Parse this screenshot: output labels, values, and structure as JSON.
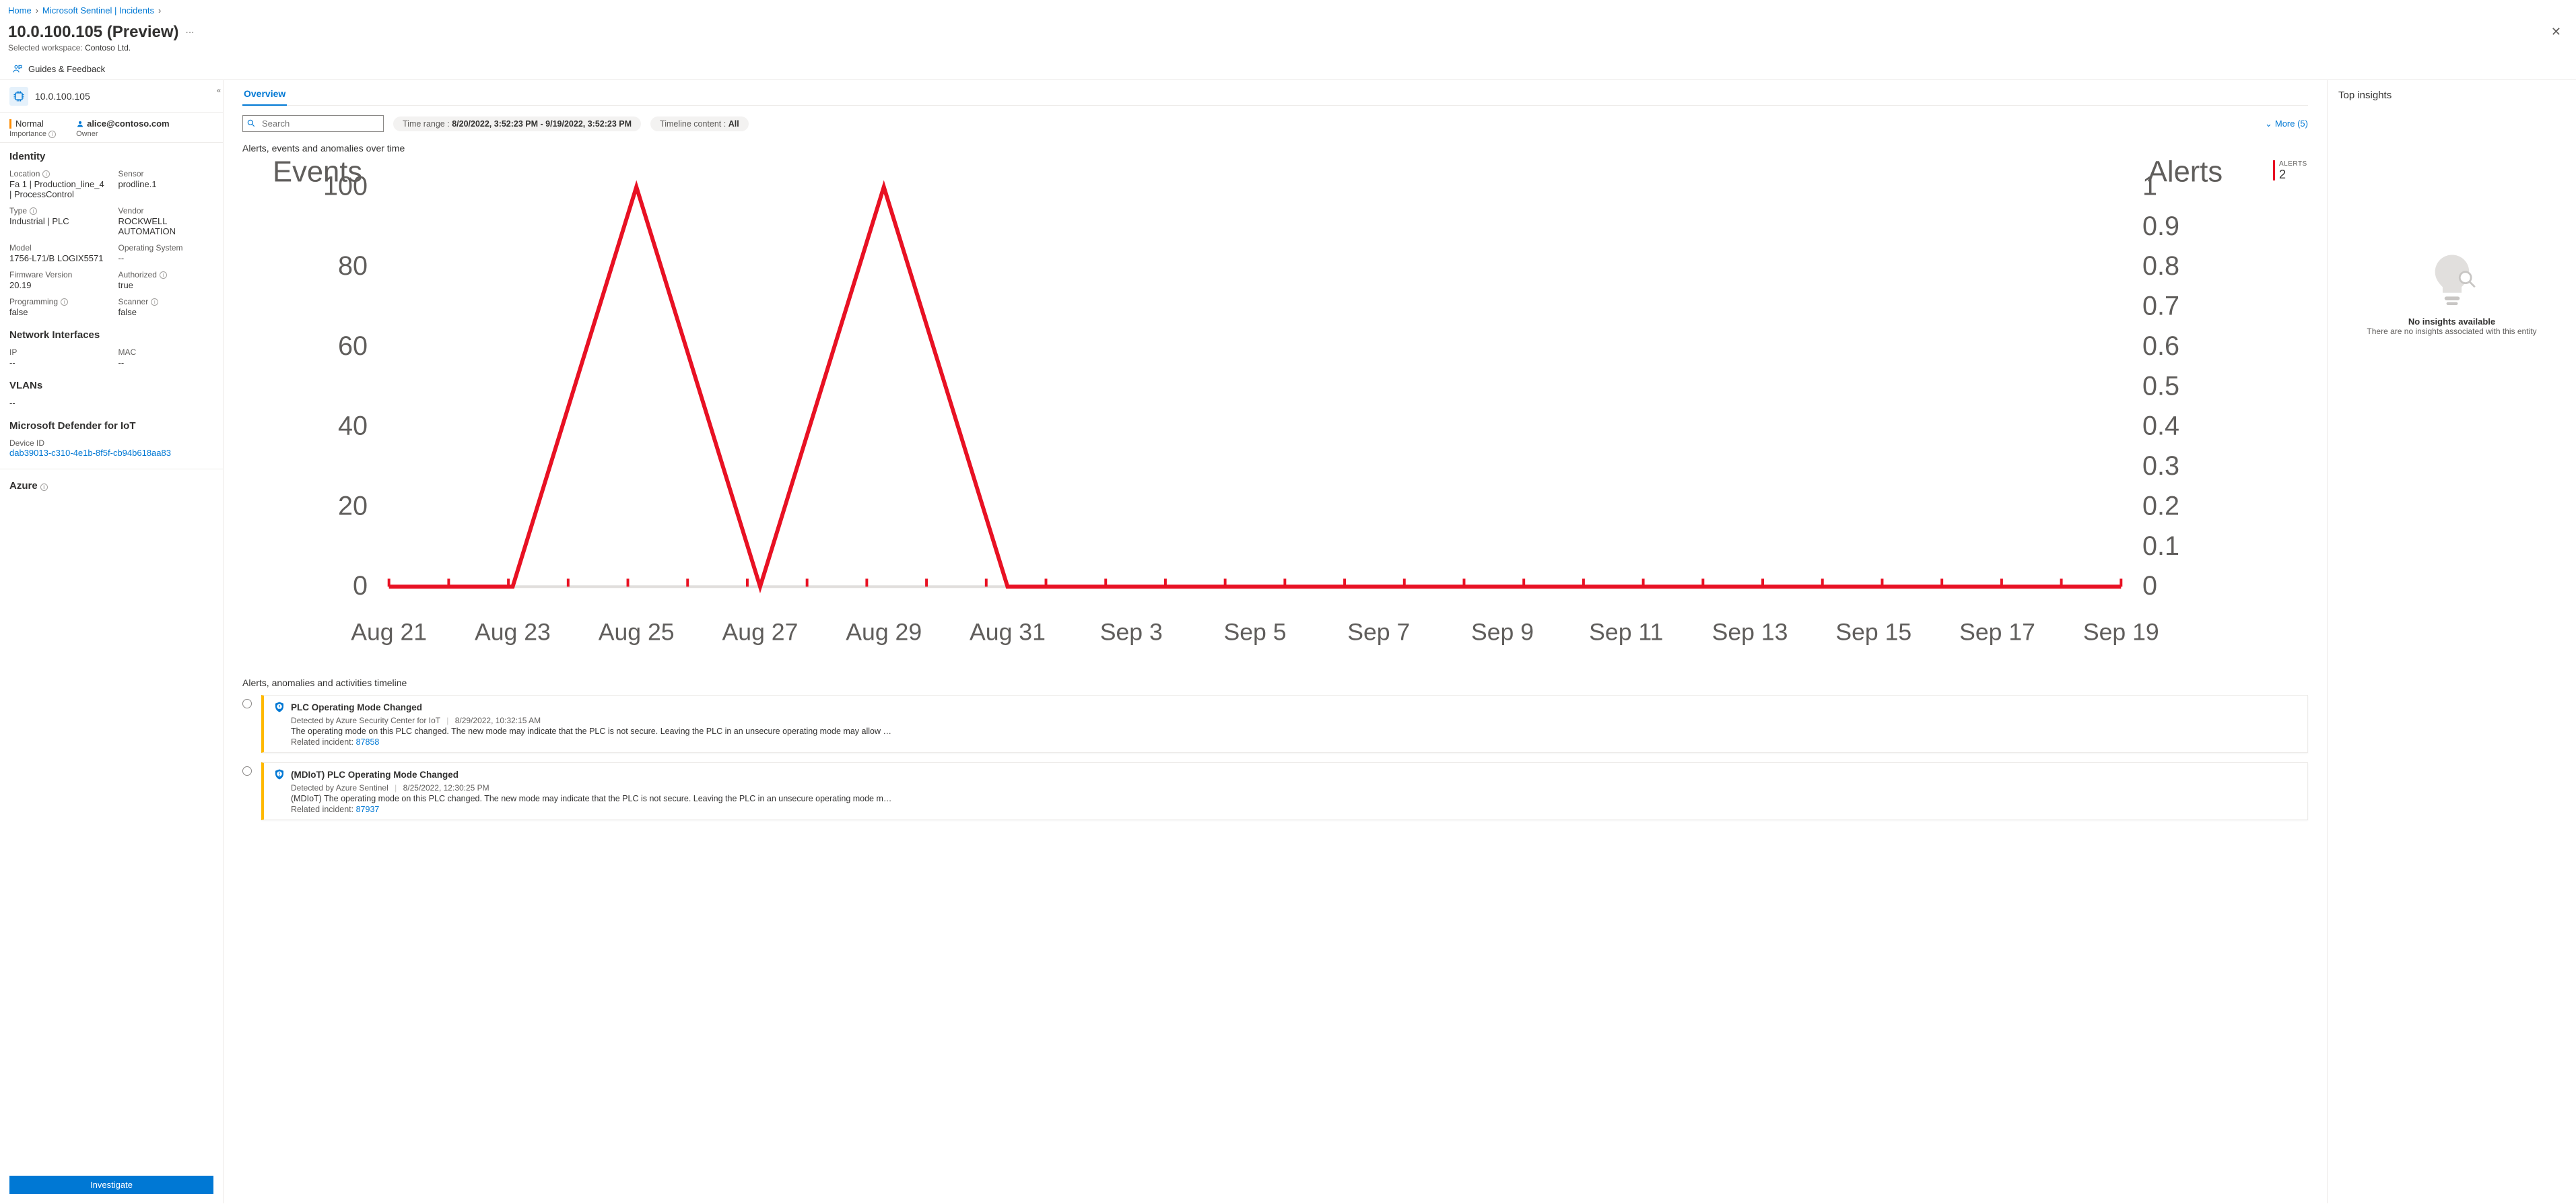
{
  "breadcrumbs": {
    "home": "Home",
    "sentinel": "Microsoft Sentinel | Incidents"
  },
  "header": {
    "title": "10.0.100.105 (Preview)",
    "workspace_label": "Selected workspace:",
    "workspace_value": "Contoso Ltd.",
    "feedback": "Guides & Feedback"
  },
  "left": {
    "ip": "10.0.100.105",
    "importance_value": "Normal",
    "importance_label": "Importance",
    "owner_label": "Owner",
    "owner_email": "alice@contoso.com",
    "identity_title": "Identity",
    "identity": {
      "location_k": "Location",
      "location_v": "Fa 1 | Production_line_4 | ProcessControl",
      "sensor_k": "Sensor",
      "sensor_v": "prodline.1",
      "type_k": "Type",
      "type_v": "Industrial | PLC",
      "vendor_k": "Vendor",
      "vendor_v": "ROCKWELL AUTOMATION",
      "model_k": "Model",
      "model_v": "1756-L71/B LOGIX5571",
      "os_k": "Operating System",
      "os_v": "--",
      "fw_k": "Firmware Version",
      "fw_v": "20.19",
      "auth_k": "Authorized",
      "auth_v": "true",
      "prog_k": "Programming",
      "prog_v": "false",
      "scan_k": "Scanner",
      "scan_v": "false"
    },
    "net_title": "Network Interfaces",
    "net": {
      "ip_k": "IP",
      "ip_v": "--",
      "mac_k": "MAC",
      "mac_v": "--"
    },
    "vlan_title": "VLANs",
    "vlan_v": "--",
    "mdiot_title": "Microsoft Defender for IoT",
    "mdiot_deviceid_k": "Device ID",
    "mdiot_deviceid_v": "dab39013-c310-4e1b-8f5f-cb94b618aa83",
    "azure_title": "Azure",
    "investigate": "Investigate"
  },
  "overview": {
    "tab": "Overview",
    "search_placeholder": "Search",
    "time_range_label": "Time range : ",
    "time_range_value": "8/20/2022, 3:52:23 PM - 9/19/2022, 3:52:23 PM",
    "timeline_content_label": "Timeline content : ",
    "timeline_content_value": "All",
    "more": "More (5)",
    "chart_title": "Alerts, events and anomalies over time",
    "events_axis": "Events",
    "alerts_axis": "Alerts",
    "alerts_kpi_label": "ALERTS",
    "alerts_kpi_value": "2",
    "timeline_title": "Alerts, anomalies and activities timeline",
    "items": [
      {
        "title": "PLC Operating Mode Changed",
        "detected_by": "Detected by Azure Security Center for IoT",
        "timestamp": "8/29/2022, 10:32:15 AM",
        "desc": "The operating mode on this PLC changed. The new mode may indicate that the PLC is not secure. Leaving the PLC in an unsecure operating mode may allow …",
        "related_label": "Related incident: ",
        "related_id": "87858"
      },
      {
        "title": "(MDIoT) PLC Operating Mode Changed",
        "detected_by": "Detected by Azure Sentinel",
        "timestamp": "8/25/2022, 12:30:25 PM",
        "desc": "(MDIoT) The operating mode on this PLC changed. The new mode may indicate that the PLC is not secure. Leaving the PLC in an unsecure operating mode m…",
        "related_label": "Related incident: ",
        "related_id": "87937"
      }
    ]
  },
  "right": {
    "title": "Top insights",
    "empty_title": "No insights available",
    "empty_sub": "There are no insights associated with this entity"
  },
  "chart_data": {
    "type": "line",
    "title": "Alerts, events and anomalies over time",
    "x_categories": [
      "Aug 21",
      "Aug 23",
      "Aug 25",
      "Aug 27",
      "Aug 29",
      "Aug 31",
      "Sep 3",
      "Sep 5",
      "Sep 7",
      "Sep 9",
      "Sep 11",
      "Sep 13",
      "Sep 15",
      "Sep 17",
      "Sep 19"
    ],
    "series": [
      {
        "name": "Events",
        "axis": "left",
        "values": [
          0,
          0,
          100,
          0,
          100,
          0,
          0,
          0,
          0,
          0,
          0,
          0,
          0,
          0,
          0
        ]
      },
      {
        "name": "Alerts",
        "axis": "right",
        "values": [
          0,
          0,
          0,
          0,
          0,
          0,
          0,
          0,
          0,
          0,
          0,
          0,
          0,
          0,
          0
        ]
      }
    ],
    "left_axis": {
      "label": "Events",
      "ticks": [
        0,
        20,
        40,
        60,
        80,
        100
      ],
      "ylim": [
        0,
        100
      ]
    },
    "right_axis": {
      "label": "Alerts",
      "ticks": [
        0,
        0.1,
        0.2,
        0.3,
        0.4,
        0.5,
        0.6,
        0.7,
        0.8,
        0.9,
        1
      ],
      "ylim": [
        0,
        1
      ]
    }
  }
}
